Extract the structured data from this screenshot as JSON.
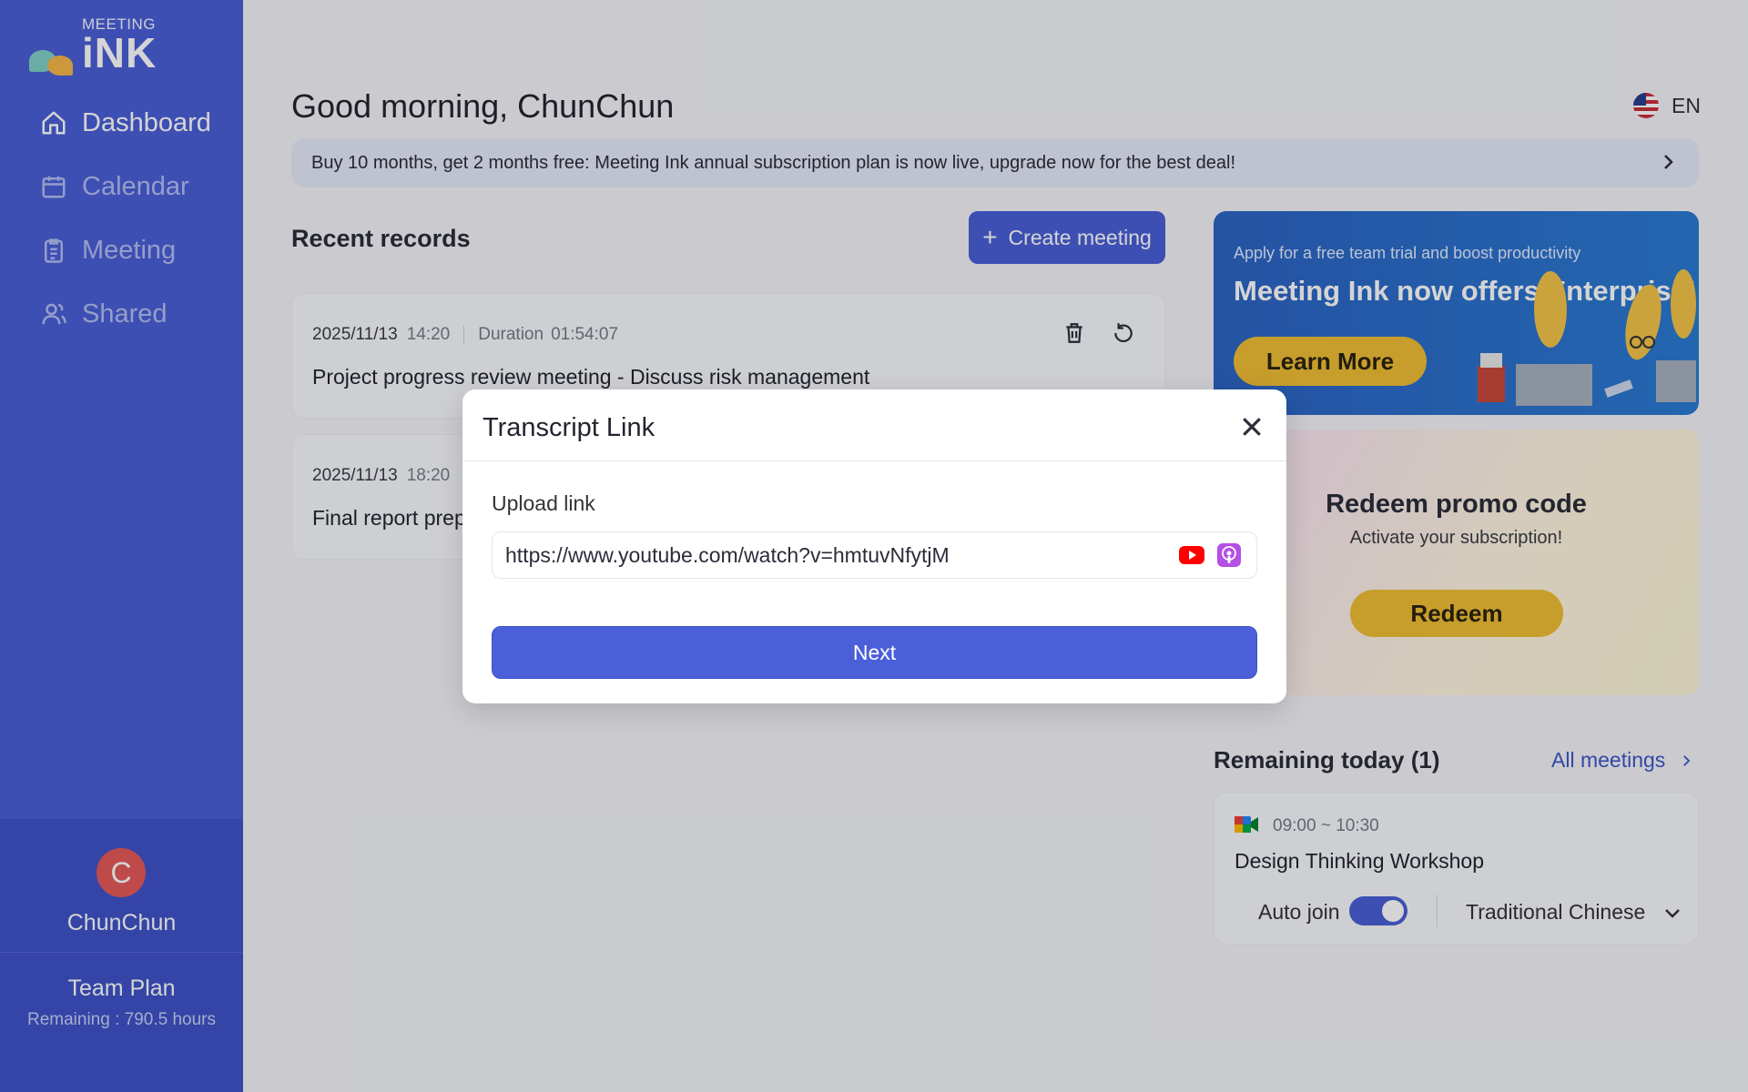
{
  "brand": {
    "small": "MEETING",
    "big": "iNK"
  },
  "nav": [
    {
      "label": "Dashboard",
      "icon": "home-icon"
    },
    {
      "label": "Calendar",
      "icon": "calendar-icon"
    },
    {
      "label": "Meeting",
      "icon": "clipboard-icon"
    },
    {
      "label": "Shared",
      "icon": "users-icon"
    }
  ],
  "user": {
    "initial": "C",
    "name": "ChunChun",
    "plan": "Team Plan",
    "remaining": "Remaining : 790.5 hours"
  },
  "header": {
    "greeting": "Good morning, ChunChun",
    "lang": "EN"
  },
  "banner": "Buy 10 months, get 2 months free: Meeting Ink annual subscription plan is now live, upgrade now for the best deal!",
  "recent": {
    "title": "Recent records",
    "create": "Create meeting",
    "records": [
      {
        "date": "2025/11/13",
        "time": "14:20",
        "duration_label": "Duration",
        "duration": "01:54:07",
        "title": "Project progress review meeting - Discuss risk management"
      },
      {
        "date": "2025/11/13",
        "time": "18:20",
        "title": "Final report prep"
      }
    ]
  },
  "enterprise": {
    "subtitle": "Apply for a free team trial and boost productivity",
    "title": "Meeting Ink now offers Enterprise!",
    "button": "Learn More"
  },
  "promo": {
    "title": "Redeem promo code",
    "subtitle": "Activate your subscription!",
    "button": "Redeem"
  },
  "remaining_today": {
    "title": "Remaining today (1)",
    "link": "All meetings",
    "meeting": {
      "time": "09:00 ~ 10:30",
      "title": "Design Thinking Workshop",
      "auto_join": "Auto join",
      "auto_join_on": true,
      "language": "Traditional Chinese"
    }
  },
  "modal": {
    "title": "Transcript Link",
    "upload_label": "Upload link",
    "url_value": "https://www.youtube.com/watch?v=hmtuvNfytjM",
    "next": "Next"
  },
  "colors": {
    "primary": "#4a5fd8",
    "accent": "#f0be36",
    "avatar": "#e55a5a"
  }
}
